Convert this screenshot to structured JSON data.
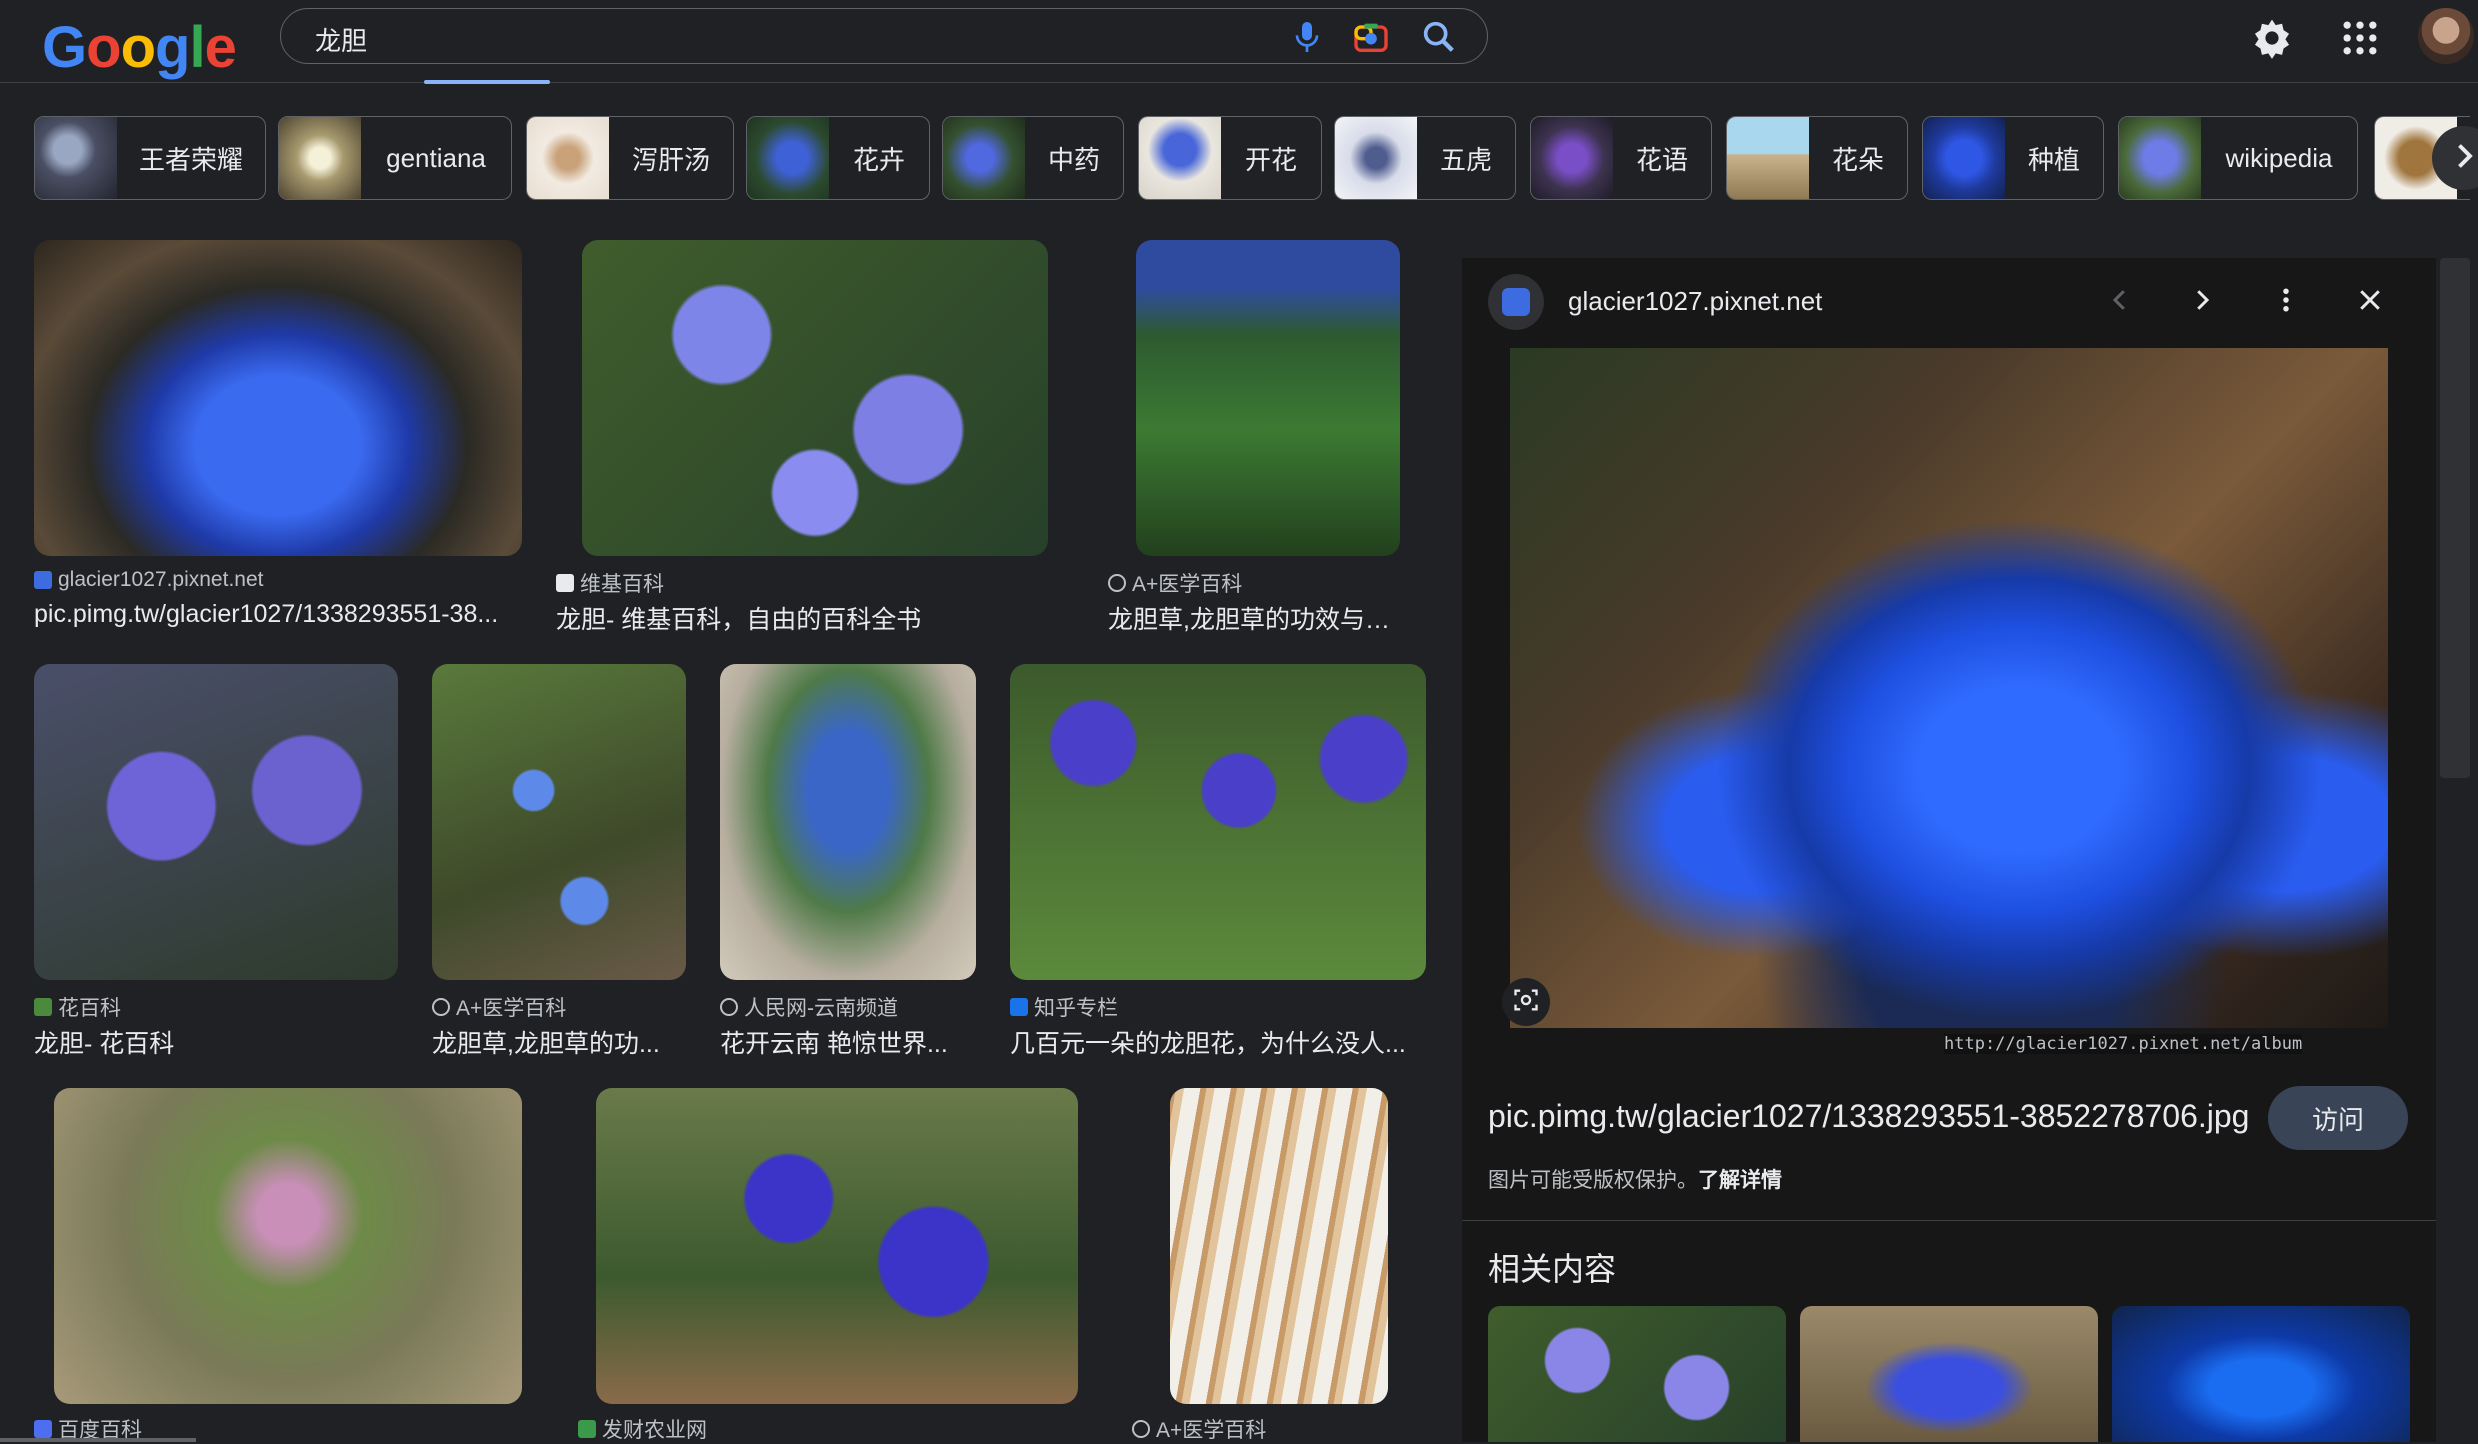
{
  "header": {
    "logo_letters": [
      "G",
      "o",
      "o",
      "g",
      "l",
      "e"
    ],
    "query": "龙胆"
  },
  "chips": [
    {
      "label": "王者荣耀"
    },
    {
      "label": "gentiana"
    },
    {
      "label": "泻肝汤"
    },
    {
      "label": "花卉"
    },
    {
      "label": "中药"
    },
    {
      "label": "开花"
    },
    {
      "label": "五虎"
    },
    {
      "label": "花语"
    },
    {
      "label": "花朵"
    },
    {
      "label": "种植"
    },
    {
      "label": "wikipedia"
    }
  ],
  "results": [
    {
      "source": "glacier1027.pixnet.net",
      "title": "pic.pimg.tw/glacier1027/1338293551-38..."
    },
    {
      "source": "维基百科",
      "title": "龙胆- 维基百科，自由的百科全书"
    },
    {
      "source": "A+医学百科",
      "title": "龙胆草,龙胆草的功效与作..."
    },
    {
      "source": "花百科",
      "title": "龙胆- 花百科"
    },
    {
      "source": "A+医学百科",
      "title": "龙胆草,龙胆草的功..."
    },
    {
      "source": "人民网-云南频道",
      "title": "花开云南 艳惊世界..."
    },
    {
      "source": "知乎专栏",
      "title": "几百元一朵的龙胆花，为什么没人..."
    },
    {
      "source": "百度百科",
      "title": ""
    },
    {
      "source": "发财农业网",
      "title": ""
    },
    {
      "source": "A+医学百科",
      "title": ""
    }
  ],
  "panel": {
    "site": "glacier1027.pixnet.net",
    "watermark": "http://glacier1027.pixnet.net/album",
    "url": "pic.pimg.tw/glacier1027/1338293551-3852278706.jpg",
    "visit": "访问",
    "copyright": "图片可能受版权保护。",
    "learn_more": "了解详情",
    "related": "相关内容"
  },
  "colors": {
    "background": "#202124",
    "accent": "#8ab4f8",
    "visit_button": "#394457"
  },
  "icons": [
    "mic-icon",
    "camera-icon",
    "search-icon",
    "gear-icon",
    "apps-icon",
    "chevron-right-icon",
    "chevron-left-icon",
    "more-vert-icon",
    "close-icon",
    "lens-icon"
  ]
}
